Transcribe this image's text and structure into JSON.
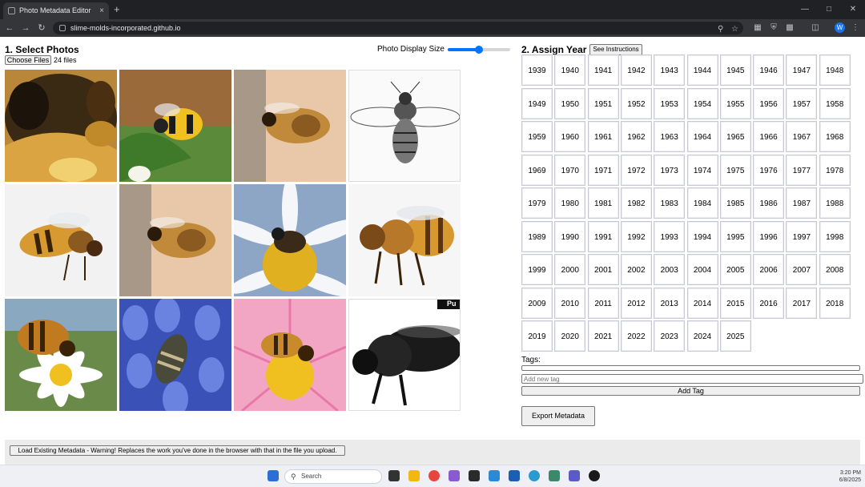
{
  "browser": {
    "tab_title": "Photo Metadata Editor",
    "tab_close": "×",
    "new_tab": "+",
    "url": "slime-molds-incorporated.github.io"
  },
  "page": {
    "select_heading": "1. Select Photos",
    "choose_files_label": "Choose Files",
    "file_count": "24 files",
    "display_size_label": "Photo Display Size",
    "display_size_value": 0.5,
    "assign_heading": "2. Assign Year",
    "instructions_label": "See Instructions",
    "years": [
      "1939",
      "1940",
      "1941",
      "1942",
      "1943",
      "1944",
      "1945",
      "1946",
      "1947",
      "1948",
      "1949",
      "1950",
      "1951",
      "1952",
      "1953",
      "1954",
      "1955",
      "1956",
      "1957",
      "1958",
      "1959",
      "1960",
      "1961",
      "1962",
      "1963",
      "1964",
      "1965",
      "1966",
      "1967",
      "1968",
      "1969",
      "1970",
      "1971",
      "1972",
      "1973",
      "1974",
      "1975",
      "1976",
      "1977",
      "1978",
      "1979",
      "1980",
      "1981",
      "1982",
      "1983",
      "1984",
      "1985",
      "1986",
      "1987",
      "1988",
      "1989",
      "1990",
      "1991",
      "1992",
      "1993",
      "1994",
      "1995",
      "1996",
      "1997",
      "1998",
      "1999",
      "2000",
      "2001",
      "2002",
      "2003",
      "2004",
      "2005",
      "2006",
      "2007",
      "2008",
      "2009",
      "2010",
      "2011",
      "2012",
      "2013",
      "2014",
      "2015",
      "2016",
      "2017",
      "2018",
      "2019",
      "2020",
      "2021",
      "2022",
      "2023",
      "2024",
      "2025"
    ],
    "tags_label": "Tags:",
    "new_tag_placeholder": "Add new tag",
    "add_tag_label": "Add Tag",
    "export_label": "Export Metadata",
    "load_label": "Load Existing Metadata - Warning! Replaces the work you've done in the browser with that in the file you upload.",
    "watermark_text": "Pu"
  },
  "photos": [
    {
      "name": "photo-bee-closeup-yellow",
      "icon": "bee-photo-icon"
    },
    {
      "name": "photo-bumblebee-flying",
      "icon": "bee-photo-icon"
    },
    {
      "name": "photo-bee-pink-bg",
      "icon": "bee-photo-icon"
    },
    {
      "name": "photo-bee-engraving",
      "icon": "bee-photo-icon"
    },
    {
      "name": "photo-honeybee-white",
      "icon": "bee-photo-icon"
    },
    {
      "name": "photo-bee-pink-bg-2",
      "icon": "bee-photo-icon"
    },
    {
      "name": "photo-bee-on-daisy",
      "icon": "bee-photo-icon"
    },
    {
      "name": "photo-honeybee-walking",
      "icon": "bee-photo-icon"
    },
    {
      "name": "photo-bee-on-chamomile",
      "icon": "bee-photo-icon"
    },
    {
      "name": "photo-bee-on-muscari",
      "icon": "bee-photo-icon"
    },
    {
      "name": "photo-bee-on-pink-flower",
      "icon": "bee-photo-icon"
    },
    {
      "name": "photo-black-bee",
      "icon": "bee-photo-icon"
    }
  ],
  "taskbar": {
    "search_placeholder": "Search",
    "time": "3:20 PM",
    "date": "6/8/2025"
  },
  "colors": {
    "accent": "#0075ff",
    "chrome_dark": "#202124",
    "chrome_toolbar": "#35363a"
  }
}
